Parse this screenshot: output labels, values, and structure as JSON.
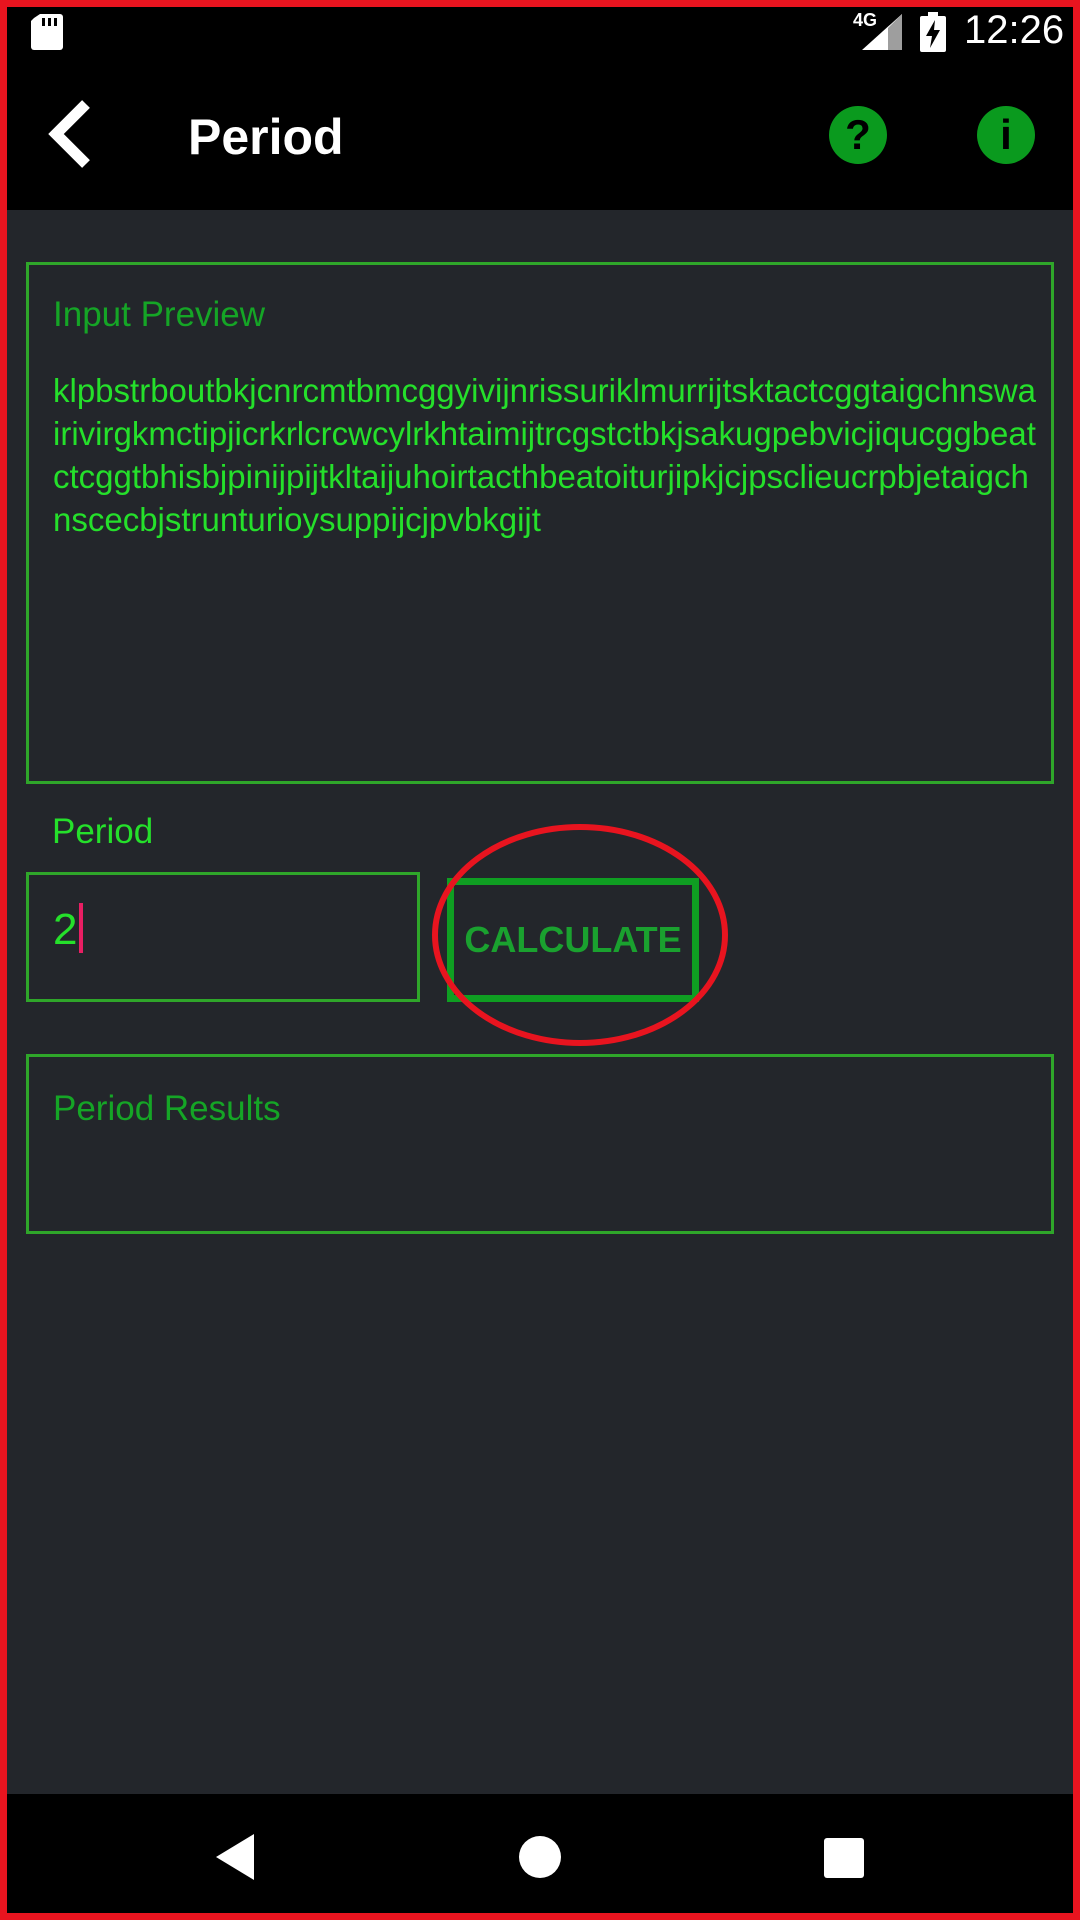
{
  "status_bar": {
    "time": "12:26",
    "network": "4G",
    "icons": [
      "sd-card-icon",
      "signal-icon",
      "battery-charging-icon"
    ]
  },
  "app_bar": {
    "title": "Period",
    "help_symbol": "?",
    "info_symbol": "i",
    "icons": [
      "back-arrow-icon",
      "help-icon",
      "info-icon"
    ]
  },
  "preview": {
    "label": "Input Preview",
    "text": "klpbstrboutbkjcnrcmtbmcggyivijnrissuriklmurrijtsktactcggtaigchnswairivirgkmctipjicrkrlcrcwcylrkhtaimijtrcgstctbkjsakugpebvicjiqucggbeatctcggtbhisbjpinijpijtkltaijuhoirtacthbeatoiturjipkjcjpsclieucrpbjetaigchnscecbjstrunturioysuppijcjpvbkgijt"
  },
  "period": {
    "label": "Period",
    "value": "2",
    "button_label": "CALCULATE"
  },
  "results": {
    "label": "Period Results"
  },
  "colors": {
    "background": "#23262b",
    "bar": "#000000",
    "accent_green": "#25e02b",
    "label_green": "#15a526",
    "border_green": "#2fa62a",
    "highlight_red": "#e8141f"
  }
}
